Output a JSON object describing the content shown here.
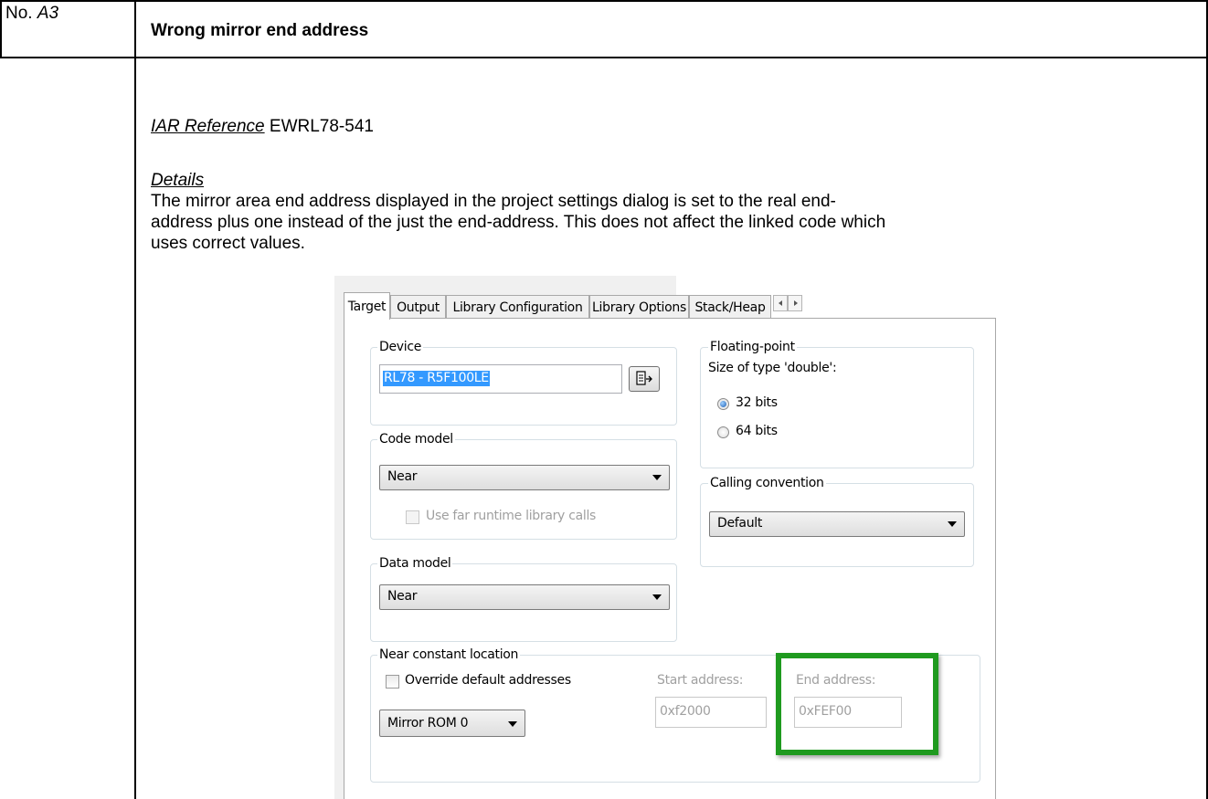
{
  "header": {
    "no_label": "No.",
    "no_value": "A3",
    "title": "Wrong mirror end address"
  },
  "reference": {
    "label": "IAR Reference",
    "value": "EWRL78-541"
  },
  "details": {
    "label": "Details",
    "lines": [
      "The mirror area end address displayed in the project settings dialog is set to the real end-",
      "address plus one instead of the just the end-address. This does not affect the linked code which",
      "uses correct values."
    ]
  },
  "dialog": {
    "tabs": [
      "Target",
      "Output",
      "Library Configuration",
      "Library Options",
      "Stack/Heap"
    ],
    "device": {
      "label": "Device",
      "value": "RL78 - R5F100LE"
    },
    "code_model": {
      "label": "Code model",
      "value": "Near",
      "far_calls_label": "Use far runtime library calls"
    },
    "data_model": {
      "label": "Data model",
      "value": "Near"
    },
    "floating_point": {
      "label": "Floating-point",
      "size_label": "Size of type 'double':",
      "opt32": "32 bits",
      "opt64": "64 bits"
    },
    "calling_convention": {
      "label": "Calling convention",
      "value": "Default"
    },
    "near_constant": {
      "label": "Near constant location",
      "override_label": "Override default addresses",
      "mirror_value": "Mirror ROM 0",
      "start_label": "Start address:",
      "start_value": "0xf2000",
      "end_label": "End address:",
      "end_value": "0xFEF00"
    },
    "highlight_color": "#1f9a1f"
  }
}
